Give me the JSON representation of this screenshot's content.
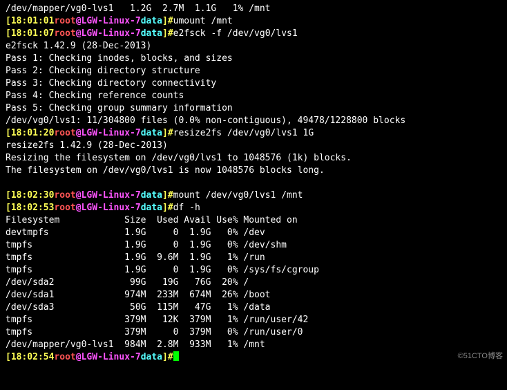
{
  "host": {
    "user": "root",
    "fqdn": "LGW-Linux-7",
    "cwd": "data",
    "bracket_open": "[",
    "bracket_close": "]",
    "at": "@",
    "hash": "#"
  },
  "times": {
    "t0": "18:01:01",
    "t1": "18:01:07",
    "t2": "18:01:20",
    "t3": "18:02:30",
    "t4": "18:02:53",
    "t5": "18:02:54"
  },
  "top_row": "/dev/mapper/vg0-lvs1   1.2G  2.7M  1.1G   1% /mnt",
  "cmds": {
    "umount": "umount /mnt",
    "e2fsck": "e2fsck -f /dev/vg0/lvs1",
    "resize": "resize2fs /dev/vg0/lvs1 1G",
    "mount": "mount /dev/vg0/lvs1 /mnt",
    "df": "df -h"
  },
  "e2fsck": [
    "e2fsck 1.42.9 (28-Dec-2013)",
    "Pass 1: Checking inodes, blocks, and sizes",
    "Pass 2: Checking directory structure",
    "Pass 3: Checking directory connectivity",
    "Pass 4: Checking reference counts",
    "Pass 5: Checking group summary information",
    "/dev/vg0/lvs1: 11/304800 files (0.0% non-contiguous), 49478/1228800 blocks"
  ],
  "resize2fs": [
    "resize2fs 1.42.9 (28-Dec-2013)",
    "Resizing the filesystem on /dev/vg0/lvs1 to 1048576 (1k) blocks.",
    "The filesystem on /dev/vg0/lvs1 is now 1048576 blocks long."
  ],
  "blank": " ",
  "df_header": "Filesystem            Size  Used Avail Use% Mounted on",
  "df_rows": [
    "devtmpfs              1.9G     0  1.9G   0% /dev",
    "tmpfs                 1.9G     0  1.9G   0% /dev/shm",
    "tmpfs                 1.9G  9.6M  1.9G   1% /run",
    "tmpfs                 1.9G     0  1.9G   0% /sys/fs/cgroup",
    "/dev/sda2              99G   19G   76G  20% /",
    "/dev/sda1             974M  233M  674M  26% /boot",
    "/dev/sda3              50G  115M   47G   1% /data",
    "tmpfs                 379M   12K  379M   1% /run/user/42",
    "tmpfs                 379M     0  379M   0% /run/user/0",
    "/dev/mapper/vg0-lvs1  984M  2.8M  933M   1% /mnt"
  ],
  "watermark": "©51CTO博客"
}
